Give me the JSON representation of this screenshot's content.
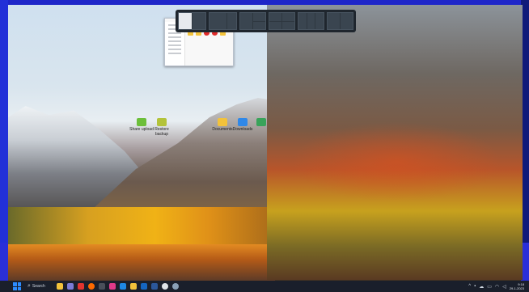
{
  "desktop": {
    "icons": [
      {
        "label": "Share\nupload",
        "icon": "folder-app-icon",
        "color": "#6cbf3a"
      },
      {
        "label": "Restore\nbackup",
        "icon": "folder-app-icon",
        "color": "#b3c33a"
      },
      {
        "label": "Documents",
        "icon": "folder-icon",
        "color": "#f2c23b"
      },
      {
        "label": "Downloads",
        "icon": "cloud-folder-icon",
        "color": "#2f88e8"
      },
      {
        "label": "",
        "icon": "app-icon",
        "color": "#39a35a"
      }
    ]
  },
  "snap_layouts": {
    "options": [
      "half-half",
      "wide-narrow",
      "three-column",
      "quad",
      "three-rows",
      "columns-2"
    ]
  },
  "taskbar": {
    "search_placeholder": "Search",
    "apps": [
      {
        "name": "file-explorer-icon",
        "color": "#f2c23b"
      },
      {
        "name": "chat-icon",
        "color": "#7b7bd6"
      },
      {
        "name": "app-red-icon",
        "color": "#e3342f"
      },
      {
        "name": "app-orange-icon",
        "color": "#ff6a00"
      },
      {
        "name": "app-dark-icon",
        "color": "#4a4f5a"
      },
      {
        "name": "app-pink-icon",
        "color": "#e03a8a"
      },
      {
        "name": "mail-icon",
        "color": "#1e88e5"
      },
      {
        "name": "folder-icon",
        "color": "#f2c23b"
      },
      {
        "name": "store-icon",
        "color": "#1565c0"
      },
      {
        "name": "word-icon",
        "color": "#2b579a"
      },
      {
        "name": "chrome-icon",
        "color": "#dfe3e8"
      },
      {
        "name": "settings-icon",
        "color": "#8aa0b6"
      }
    ],
    "tray_icons": [
      "chevron-up-icon",
      "app-tray-icon",
      "cloud-icon",
      "battery-icon",
      "wifi-icon",
      "volume-icon"
    ],
    "time": "9:18",
    "date": "29-1-2023"
  },
  "colors": {
    "accent": "#2d8cff",
    "frame": "#2230d8",
    "taskbar": "#1a1f2b"
  }
}
